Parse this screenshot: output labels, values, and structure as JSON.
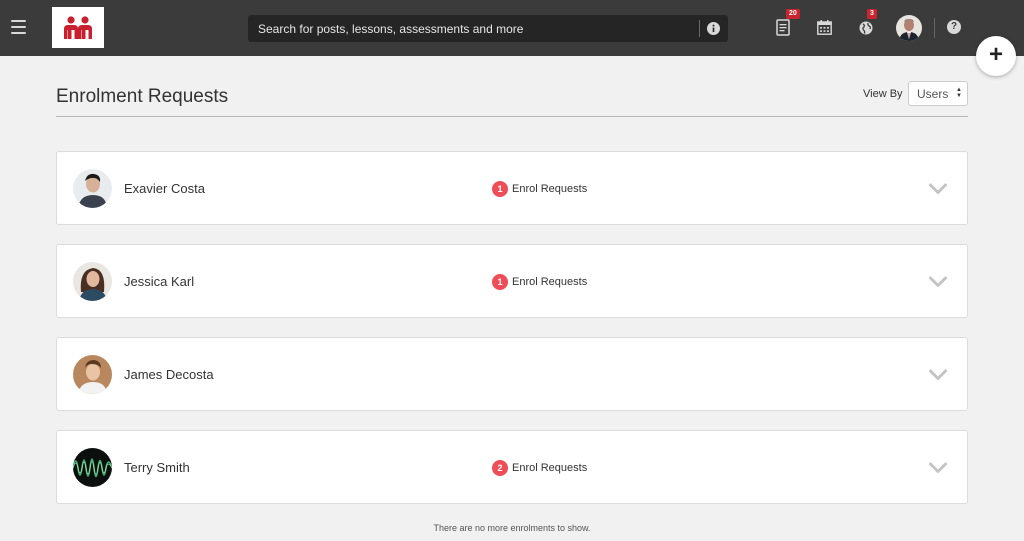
{
  "search": {
    "placeholder": "Search for posts, lessons, assessments and more"
  },
  "topbar": {
    "notifications_badge": "20",
    "globe_badge": "3"
  },
  "page": {
    "title": "Enrolment Requests",
    "view_by_label": "View By",
    "view_by_value": "Users"
  },
  "users": [
    {
      "name": "Exavier Costa",
      "request_count": "1",
      "request_label": "Enrol Requests"
    },
    {
      "name": "Jessica Karl",
      "request_count": "1",
      "request_label": "Enrol Requests"
    },
    {
      "name": "James Decosta"
    },
    {
      "name": "Terry Smith",
      "request_count": "2",
      "request_label": "Enrol Requests"
    }
  ],
  "footer": {
    "note": "There are no more enrolments to show."
  },
  "colors": {
    "topbar": "#3b3b3b",
    "badge": "#c9252f",
    "request_badge": "#ef4d57",
    "logo": "#c8202f"
  }
}
